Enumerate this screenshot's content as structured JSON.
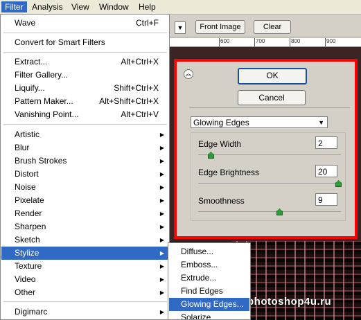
{
  "menubar": {
    "items": [
      {
        "label": "Filter"
      },
      {
        "label": "Analysis"
      },
      {
        "label": "View"
      },
      {
        "label": "Window"
      },
      {
        "label": "Help"
      }
    ]
  },
  "options_bar": {
    "front_image_label": "Front Image",
    "clear_label": "Clear"
  },
  "ruler": {
    "ticks": [
      "600",
      "700",
      "800",
      "900"
    ]
  },
  "filter_menu": {
    "items": [
      {
        "label": "Wave",
        "shortcut": "Ctrl+F"
      },
      {
        "label": "Convert for Smart Filters",
        "shortcut": ""
      },
      {
        "label": "Extract...",
        "shortcut": "Alt+Ctrl+X"
      },
      {
        "label": "Filter Gallery...",
        "shortcut": ""
      },
      {
        "label": "Liquify...",
        "shortcut": "Shift+Ctrl+X"
      },
      {
        "label": "Pattern Maker...",
        "shortcut": "Alt+Shift+Ctrl+X"
      },
      {
        "label": "Vanishing Point...",
        "shortcut": "Alt+Ctrl+V"
      },
      {
        "label": "Artistic"
      },
      {
        "label": "Blur"
      },
      {
        "label": "Brush Strokes"
      },
      {
        "label": "Distort"
      },
      {
        "label": "Noise"
      },
      {
        "label": "Pixelate"
      },
      {
        "label": "Render"
      },
      {
        "label": "Sharpen"
      },
      {
        "label": "Sketch"
      },
      {
        "label": "Stylize"
      },
      {
        "label": "Texture"
      },
      {
        "label": "Video"
      },
      {
        "label": "Other"
      },
      {
        "label": "Digimarc"
      }
    ]
  },
  "stylize_submenu": {
    "items": [
      {
        "label": "Diffuse..."
      },
      {
        "label": "Emboss..."
      },
      {
        "label": "Extrude..."
      },
      {
        "label": "Find Edges"
      },
      {
        "label": "Glowing Edges..."
      },
      {
        "label": "Solarize"
      }
    ]
  },
  "dialog": {
    "ok_label": "OK",
    "cancel_label": "Cancel",
    "filter_select": "Glowing Edges",
    "params": [
      {
        "label": "Edge Width",
        "value": "2",
        "fraction": 0.07
      },
      {
        "label": "Edge Brightness",
        "value": "20",
        "fraction": 1.0
      },
      {
        "label": "Smoothness",
        "value": "9",
        "fraction": 0.57
      }
    ]
  },
  "watermark": "photoshop4u.ru",
  "colors": {
    "selection": "#316ac5",
    "highlight_border": "#ff0000"
  },
  "icons": {
    "collapse": "collapse-up-icon",
    "submenu": "submenu-arrow-icon",
    "dropdown": "dropdown-arrow-icon",
    "slider": "slider-thumb-icon"
  }
}
